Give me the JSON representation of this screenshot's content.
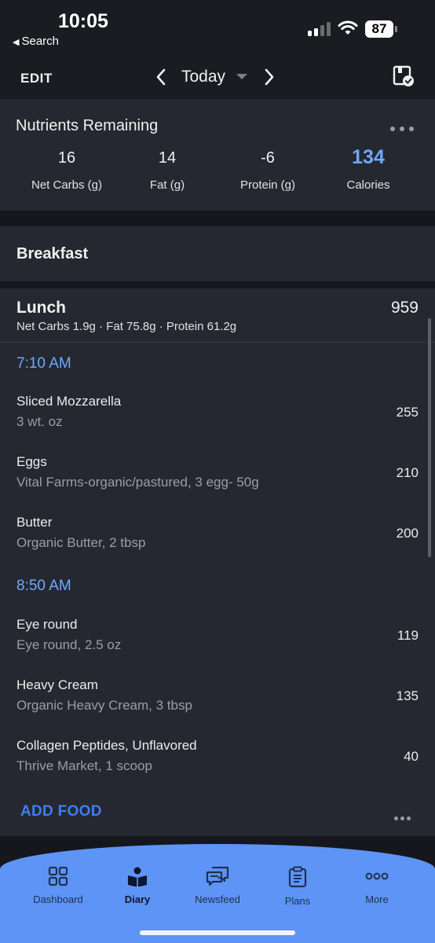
{
  "status_bar": {
    "time": "10:05",
    "back_label": "Search",
    "battery": "87"
  },
  "nav": {
    "edit_label": "EDIT",
    "date_label": "Today"
  },
  "nutrients": {
    "title": "Nutrients Remaining",
    "items": [
      {
        "value": "16",
        "label": "Net Carbs (g)"
      },
      {
        "value": "14",
        "label": "Fat (g)"
      },
      {
        "value": "-6",
        "label": "Protein (g)"
      },
      {
        "value": "134",
        "label": "Calories"
      }
    ],
    "accent_color": "#6ea8ff"
  },
  "breakfast": {
    "title": "Breakfast"
  },
  "lunch": {
    "title": "Lunch",
    "calories": "959",
    "macros": "Net Carbs 1.9g · Fat 75.8g · Protein 61.2g",
    "groups": [
      {
        "time": "7:10 AM",
        "foods": [
          {
            "name": "Sliced Mozzarella",
            "desc": "3 wt. oz",
            "calories": "255"
          },
          {
            "name": "Eggs",
            "desc": "Vital Farms-organic/pastured, 3 egg- 50g",
            "calories": "210"
          },
          {
            "name": "Butter",
            "desc": "Organic Butter, 2 tbsp",
            "calories": "200"
          }
        ]
      },
      {
        "time": "8:50 AM",
        "foods": [
          {
            "name": "Eye round",
            "desc": "Eye round, 2.5 oz",
            "calories": "119"
          },
          {
            "name": "Heavy Cream",
            "desc": "Organic Heavy Cream, 3 tbsp",
            "calories": "135"
          },
          {
            "name": "Collagen Peptides, Unflavored",
            "desc": "Thrive Market, 1 scoop",
            "calories": "40"
          }
        ]
      }
    ],
    "add_food_label": "ADD FOOD",
    "link_color": "#3e7ef5"
  },
  "tabs": [
    {
      "label": "Dashboard",
      "icon": "dashboard-icon",
      "active": false
    },
    {
      "label": "Diary",
      "icon": "diary-icon",
      "active": true
    },
    {
      "label": "Newsfeed",
      "icon": "newsfeed-icon",
      "active": false
    },
    {
      "label": "Plans",
      "icon": "plans-icon",
      "active": false
    },
    {
      "label": "More",
      "icon": "more-icon",
      "active": false
    }
  ],
  "tabbar_color": "#5d94f6"
}
